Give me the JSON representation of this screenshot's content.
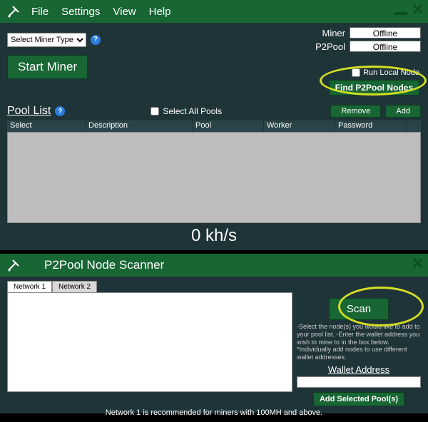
{
  "menu": {
    "file": "File",
    "settings": "Settings",
    "view": "View",
    "help": "Help"
  },
  "miner_type_placeholder": "Select Miner Type",
  "start_miner": "Start Miner",
  "status": {
    "miner_label": "Miner",
    "miner_value": "Offline",
    "p2pool_label": "P2Pool",
    "p2pool_value": "Offline"
  },
  "run_local": "Run Local Node",
  "find_nodes": "Find P2Pool Nodes",
  "pool_list": {
    "title": "Pool List",
    "select_all": "Select All Pools",
    "remove": "Remove",
    "add": "Add",
    "cols": {
      "select": "Select",
      "description": "Description",
      "pool": "Pool",
      "worker": "Worker",
      "password": "Password"
    }
  },
  "hashrate": "0 kh/s",
  "scanner": {
    "title": "P2Pool Node Scanner",
    "tabs": {
      "n1": "Network 1",
      "n2": "Network 2"
    },
    "scan": "Scan",
    "instructions": "-Select the node(s) you would like to add to your pool list.\n-Enter the wallet address you wish to mine to in the box below.\n*Individually add nodes to use different wallet addresses.",
    "wallet_label": "Wallet Address",
    "add_selected": "Add Selected Pool(s)",
    "footnote": "Network 1 is recommended for miners with 100MH and above."
  }
}
